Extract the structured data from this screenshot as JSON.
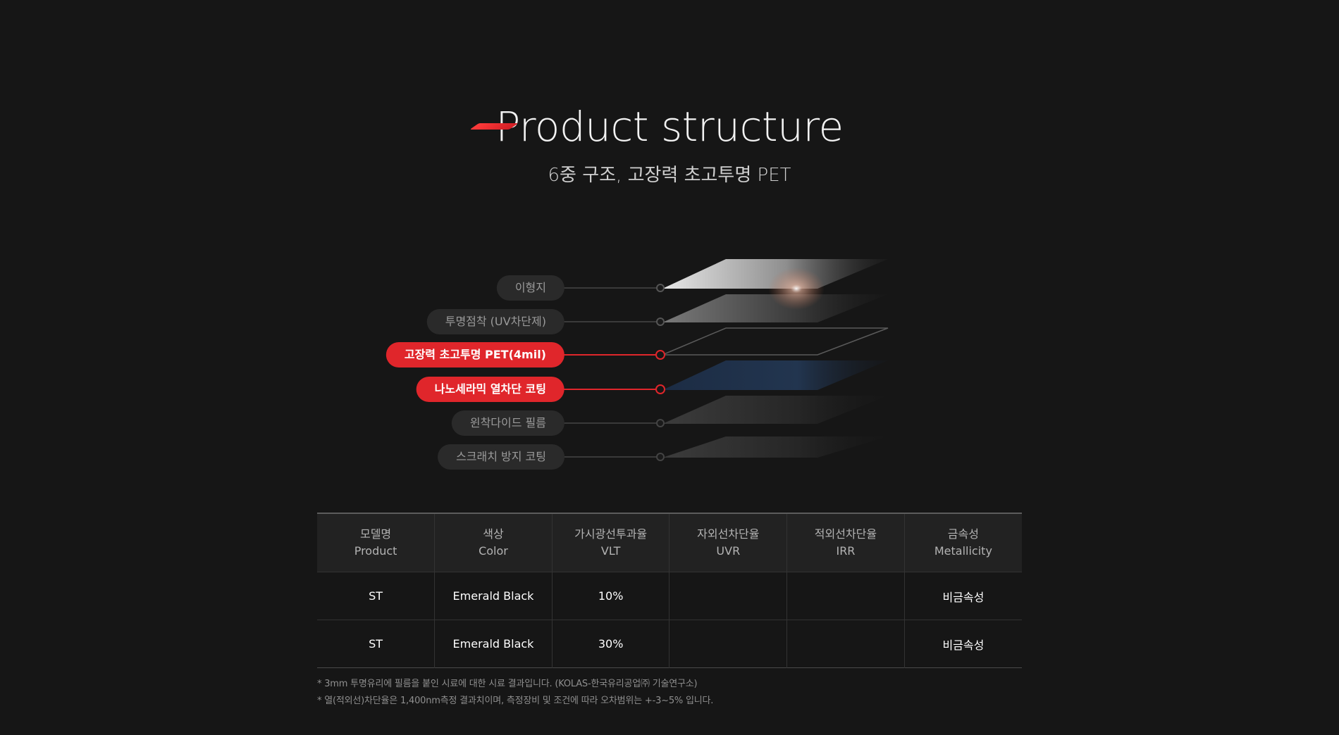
{
  "header": {
    "title": "Product structure",
    "subtitle": "6중 구조, 고장력 초고투명 PET"
  },
  "colors": {
    "accent": "#e0262b",
    "background": "#161616",
    "pill_inactive": "#2a2a2a"
  },
  "layers": [
    {
      "label": "이형지",
      "active": false
    },
    {
      "label": "투명점착 (UV차단제)",
      "active": false
    },
    {
      "label": "고장력 초고투명 PET(4mil)",
      "active": true
    },
    {
      "label": "나노세라믹 열차단 코팅",
      "active": true
    },
    {
      "label": "윈착다이드 필름",
      "active": false
    },
    {
      "label": "스크래치 방지 코팅",
      "active": false
    }
  ],
  "table": {
    "headers": [
      {
        "ko": "모델명",
        "en": "Product"
      },
      {
        "ko": "색상",
        "en": "Color"
      },
      {
        "ko": "가시광선투과율",
        "en": "VLT"
      },
      {
        "ko": "자외선차단율",
        "en": "UVR"
      },
      {
        "ko": "적외선차단율",
        "en": "IRR"
      },
      {
        "ko": "금속성",
        "en": "Metallicity"
      }
    ],
    "rows": [
      [
        "ST",
        "Emerald Black",
        "10%",
        "",
        "",
        "비금속성"
      ],
      [
        "ST",
        "Emerald Black",
        "30%",
        "",
        "",
        "비금속성"
      ]
    ]
  },
  "notes": [
    "* 3mm 투명유리에 필름을 붙인 시료에 대한 시료 결과입니다. (KOLAS-한국유리공업㈜ 기술연구소)",
    "* 열(적외선)차단율은 1,400nm측정 결과치이며, 측정장비 및 조건에 따라 오차범위는 +-3~5% 입니다."
  ]
}
